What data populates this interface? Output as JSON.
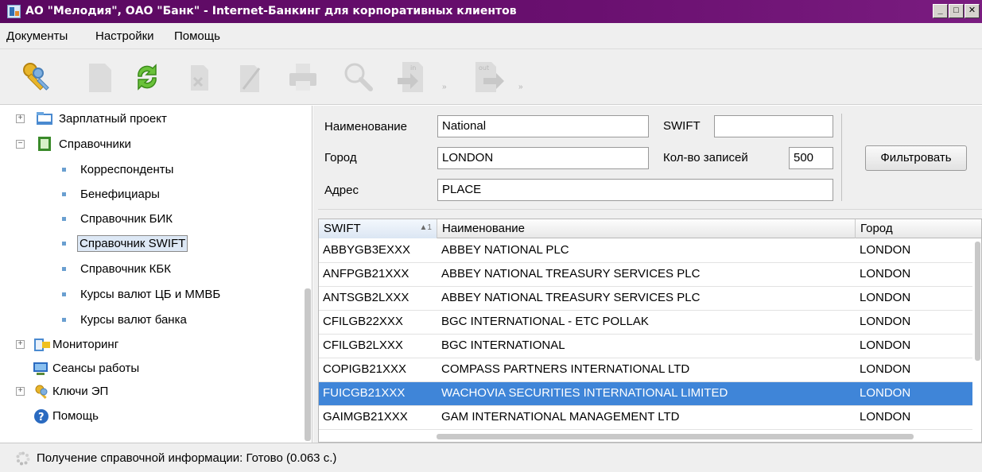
{
  "window": {
    "title": "АО \"Мелодия\", ОАО \"Банк\" - Internet-Банкинг для корпоративных клиентов",
    "minimize": "_",
    "maximize": "□",
    "close": "✕"
  },
  "menu": [
    "Документы",
    "Настройки",
    "Помощь"
  ],
  "toolbar": {
    "icons": [
      "keys-icon",
      "new-document-icon",
      "refresh-icon",
      "delete-icon",
      "edit-icon",
      "print-icon",
      "search-icon",
      "import-icon",
      "export-icon"
    ],
    "import_label": "in",
    "export_label": "out",
    "chevron": "»"
  },
  "tree": [
    {
      "label": "Зарплатный проект",
      "icon": "folder-icon",
      "expander": "+"
    },
    {
      "label": "Справочники",
      "icon": "book-icon",
      "expander": "−"
    },
    {
      "label": "Корреспонденты"
    },
    {
      "label": "Бенефициары"
    },
    {
      "label": "Справочник БИК"
    },
    {
      "label": "Справочник SWIFT",
      "selected": true
    },
    {
      "label": "Справочник КБК"
    },
    {
      "label": "Курсы валют ЦБ и ММВБ"
    },
    {
      "label": "Курсы валют банка"
    },
    {
      "label": "Мониторинг",
      "icon": "monitoring-icon",
      "expander": "+"
    },
    {
      "label": "Сеансы работы",
      "icon": "sessions-icon"
    },
    {
      "label": "Ключи ЭП",
      "icon": "key-icon",
      "expander": "+"
    },
    {
      "label": "Помощь",
      "icon": "help-icon"
    }
  ],
  "filter": {
    "name_label": "Наименование",
    "name_value": "National",
    "swift_label": "SWIFT",
    "swift_value": "",
    "city_label": "Город",
    "city_value": "LONDON",
    "count_label": "Кол-во записей",
    "count_value": "500",
    "address_label": "Адрес",
    "address_value": "PLACE",
    "filter_button": "Фильтровать"
  },
  "table": {
    "columns": [
      "SWIFT",
      "Наименование",
      "Город"
    ],
    "sort_indicator": "▲1",
    "rows": [
      [
        "ABBYGB3EXXX",
        "ABBEY NATIONAL PLC",
        "LONDON"
      ],
      [
        "ANFPGB21XXX",
        "ABBEY NATIONAL TREASURY SERVICES PLC",
        "LONDON"
      ],
      [
        "ANTSGB2LXXX",
        "ABBEY NATIONAL TREASURY SERVICES PLC",
        "LONDON"
      ],
      [
        "CFILGB22XXX",
        "BGC INTERNATIONAL - ETC POLLAK",
        "LONDON"
      ],
      [
        "CFILGB2LXXX",
        "BGC INTERNATIONAL",
        "LONDON"
      ],
      [
        "COPIGB21XXX",
        "COMPASS PARTNERS INTERNATIONAL LTD",
        "LONDON"
      ],
      [
        "FUICGB21XXX",
        "WACHOVIA SECURITIES INTERNATIONAL LIMITED",
        "LONDON"
      ],
      [
        "GAIMGB21XXX",
        "GAM INTERNATIONAL MANAGEMENT LTD",
        "LONDON"
      ]
    ],
    "selected_row": 6
  },
  "status": {
    "text": "Получение справочной информации: Готово (0.063 с.)"
  },
  "colors": {
    "titlebar": "#5a0860",
    "selection": "#3f85d8",
    "bullet": "#6a9fd0"
  }
}
